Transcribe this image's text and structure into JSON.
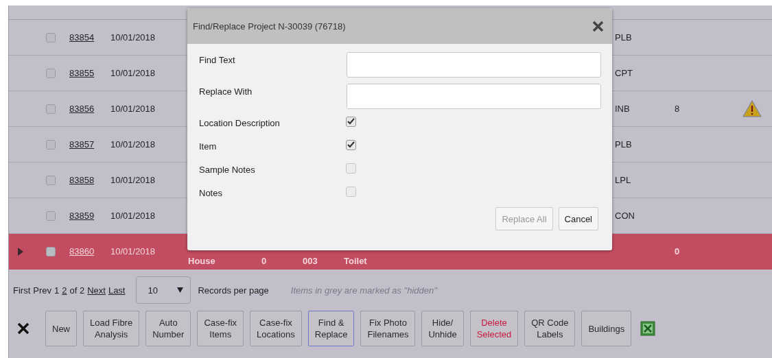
{
  "dialog": {
    "title": "Find/Replace Project N-30039 (76718)",
    "fields": [
      {
        "label": "Find Text"
      },
      {
        "label": "Replace With"
      }
    ],
    "options": [
      {
        "label": "Location Description",
        "checked": true
      },
      {
        "label": "Item",
        "checked": true
      },
      {
        "label": "Sample Notes",
        "checked": false
      },
      {
        "label": "Notes",
        "checked": false
      }
    ],
    "buttons": [
      {
        "label": "Replace All",
        "disabled": true
      },
      {
        "label": "Cancel",
        "disabled": false
      }
    ]
  },
  "table": {
    "rows": [
      {
        "id": "83854",
        "date": "10/01/2018",
        "code": "PLB",
        "selected": false,
        "checked": false,
        "warning": false
      },
      {
        "id": "83855",
        "date": "10/01/2018",
        "code": "CPT",
        "selected": false,
        "checked": false,
        "warning": false
      },
      {
        "id": "83856",
        "date": "10/01/2018",
        "code": "INB",
        "count": "8",
        "selected": false,
        "checked": false,
        "warning": true
      },
      {
        "id": "83857",
        "date": "10/01/2018",
        "code": "PLB",
        "selected": false,
        "checked": false,
        "warning": false
      },
      {
        "id": "83858",
        "date": "10/01/2018",
        "code": "LPL",
        "selected": false,
        "checked": false,
        "warning": false
      },
      {
        "id": "83859",
        "date": "10/01/2018",
        "code": "CON",
        "selected": false,
        "checked": false,
        "warning": false
      },
      {
        "id": "83860",
        "date": "10/01/2018",
        "location": "House",
        "column_5": "0",
        "column_6": "003",
        "column_7": "Toilet",
        "count": "0",
        "selected": true,
        "checked": false,
        "warning": false
      }
    ]
  },
  "pagination": {
    "items": [
      {
        "label": "First",
        "link": false
      },
      {
        "label": "Prev",
        "link": false
      },
      {
        "label": "1",
        "link": false
      },
      {
        "label": "2",
        "link": true
      },
      {
        "label": "of 2",
        "link": false
      },
      {
        "label": "Next",
        "link": true
      },
      {
        "label": "Last",
        "link": true
      }
    ],
    "page_size": "10",
    "page_size_label": "Records per page",
    "hint": "Items in grey are marked as \"hidden\""
  },
  "toolbar": {
    "buttons": [
      {
        "label": "New",
        "kind": "normal",
        "focused": false
      },
      {
        "label": "Load Fibre\nAnalysis",
        "kind": "normal",
        "focused": false
      },
      {
        "label": "Auto\nNumber",
        "kind": "normal",
        "focused": false
      },
      {
        "label": "Case-fix\nItems",
        "kind": "normal",
        "focused": false
      },
      {
        "label": "Case-fix\nLocations",
        "kind": "normal",
        "focused": false
      },
      {
        "label": "Find &\nReplace",
        "kind": "normal",
        "focused": true
      },
      {
        "label": "Fix Photo\nFilenames",
        "kind": "normal",
        "focused": false
      },
      {
        "label": "Hide/\nUnhide",
        "kind": "normal",
        "focused": false
      },
      {
        "label": "Delete\nSelected",
        "kind": "danger",
        "focused": false
      },
      {
        "label": "QR Code\nLabels",
        "kind": "normal",
        "focused": false
      },
      {
        "label": "Buildings",
        "kind": "normal",
        "focused": false
      }
    ]
  }
}
